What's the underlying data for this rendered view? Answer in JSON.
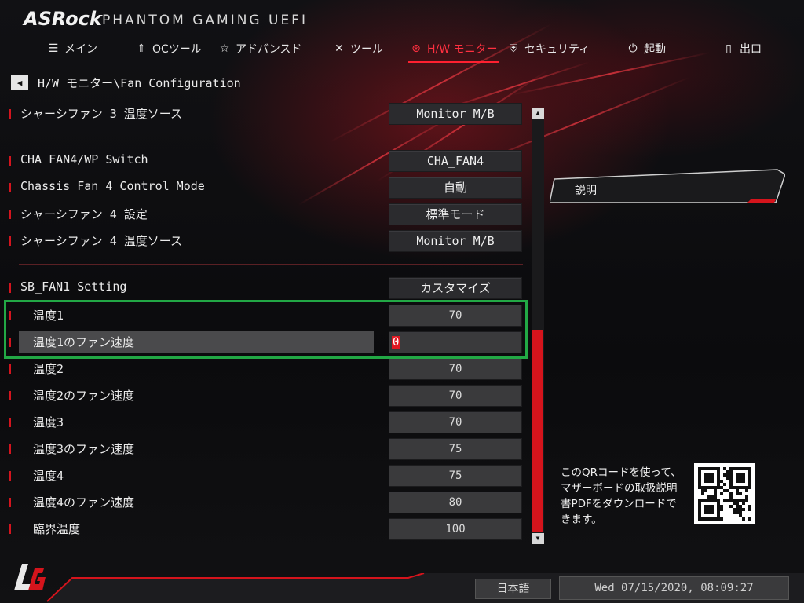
{
  "header": {
    "brand": "ASRock",
    "brand_sub": "PHANTOM GAMING UEFI",
    "nav": [
      {
        "label": "メイン",
        "icon": "list-icon"
      },
      {
        "label": "OCツール",
        "icon": "rocket-icon"
      },
      {
        "label": "アドバンスド",
        "icon": "star-icon"
      },
      {
        "label": "ツール",
        "icon": "tools-icon"
      },
      {
        "label": "H/W モニター",
        "icon": "monitor-icon",
        "active": true
      },
      {
        "label": "セキュリティ",
        "icon": "shield-icon"
      },
      {
        "label": "起動",
        "icon": "power-icon"
      },
      {
        "label": "出口",
        "icon": "exit-door-icon"
      }
    ]
  },
  "breadcrumb": {
    "path": "H/W モニター\\Fan Configuration"
  },
  "settings": [
    {
      "label": "シャーシファン 3 温度ソース",
      "value": "Monitor M/B"
    },
    {
      "label": "CHA_FAN4/WP Switch",
      "value": "CHA_FAN4"
    },
    {
      "label": "Chassis Fan 4 Control Mode",
      "value": "自動"
    },
    {
      "label": "シャーシファン 4 設定",
      "value": "標準モード"
    },
    {
      "label": "シャーシファン 4 温度ソース",
      "value": "Monitor M/B"
    },
    {
      "label": "SB_FAN1 Setting",
      "value": "カスタマイズ"
    },
    {
      "label": "温度1",
      "value": "70"
    },
    {
      "label": "温度1のファン速度",
      "value": "0"
    },
    {
      "label": "温度2",
      "value": "70"
    },
    {
      "label": "温度2のファン速度",
      "value": "70"
    },
    {
      "label": "温度3",
      "value": "70"
    },
    {
      "label": "温度3のファン速度",
      "value": "75"
    },
    {
      "label": "温度4",
      "value": "75"
    },
    {
      "label": "温度4のファン速度",
      "value": "80"
    },
    {
      "label": "臨界温度",
      "value": "100"
    }
  ],
  "selected_setting": "温度1のファン速度",
  "scrollbar": {
    "position_fraction": 0.5
  },
  "panel": {
    "description_title": "説明",
    "qr_text": "このQRコードを使って、マザーボードの取扱説明書PDFをダウンロードできます。"
  },
  "footer": {
    "language": "日本語",
    "datetime": "Wed 07/15/2020, 08:09:27"
  },
  "colors": {
    "accent": "#e01822",
    "highlight": "#22a845",
    "background": "#0d0d0f"
  }
}
